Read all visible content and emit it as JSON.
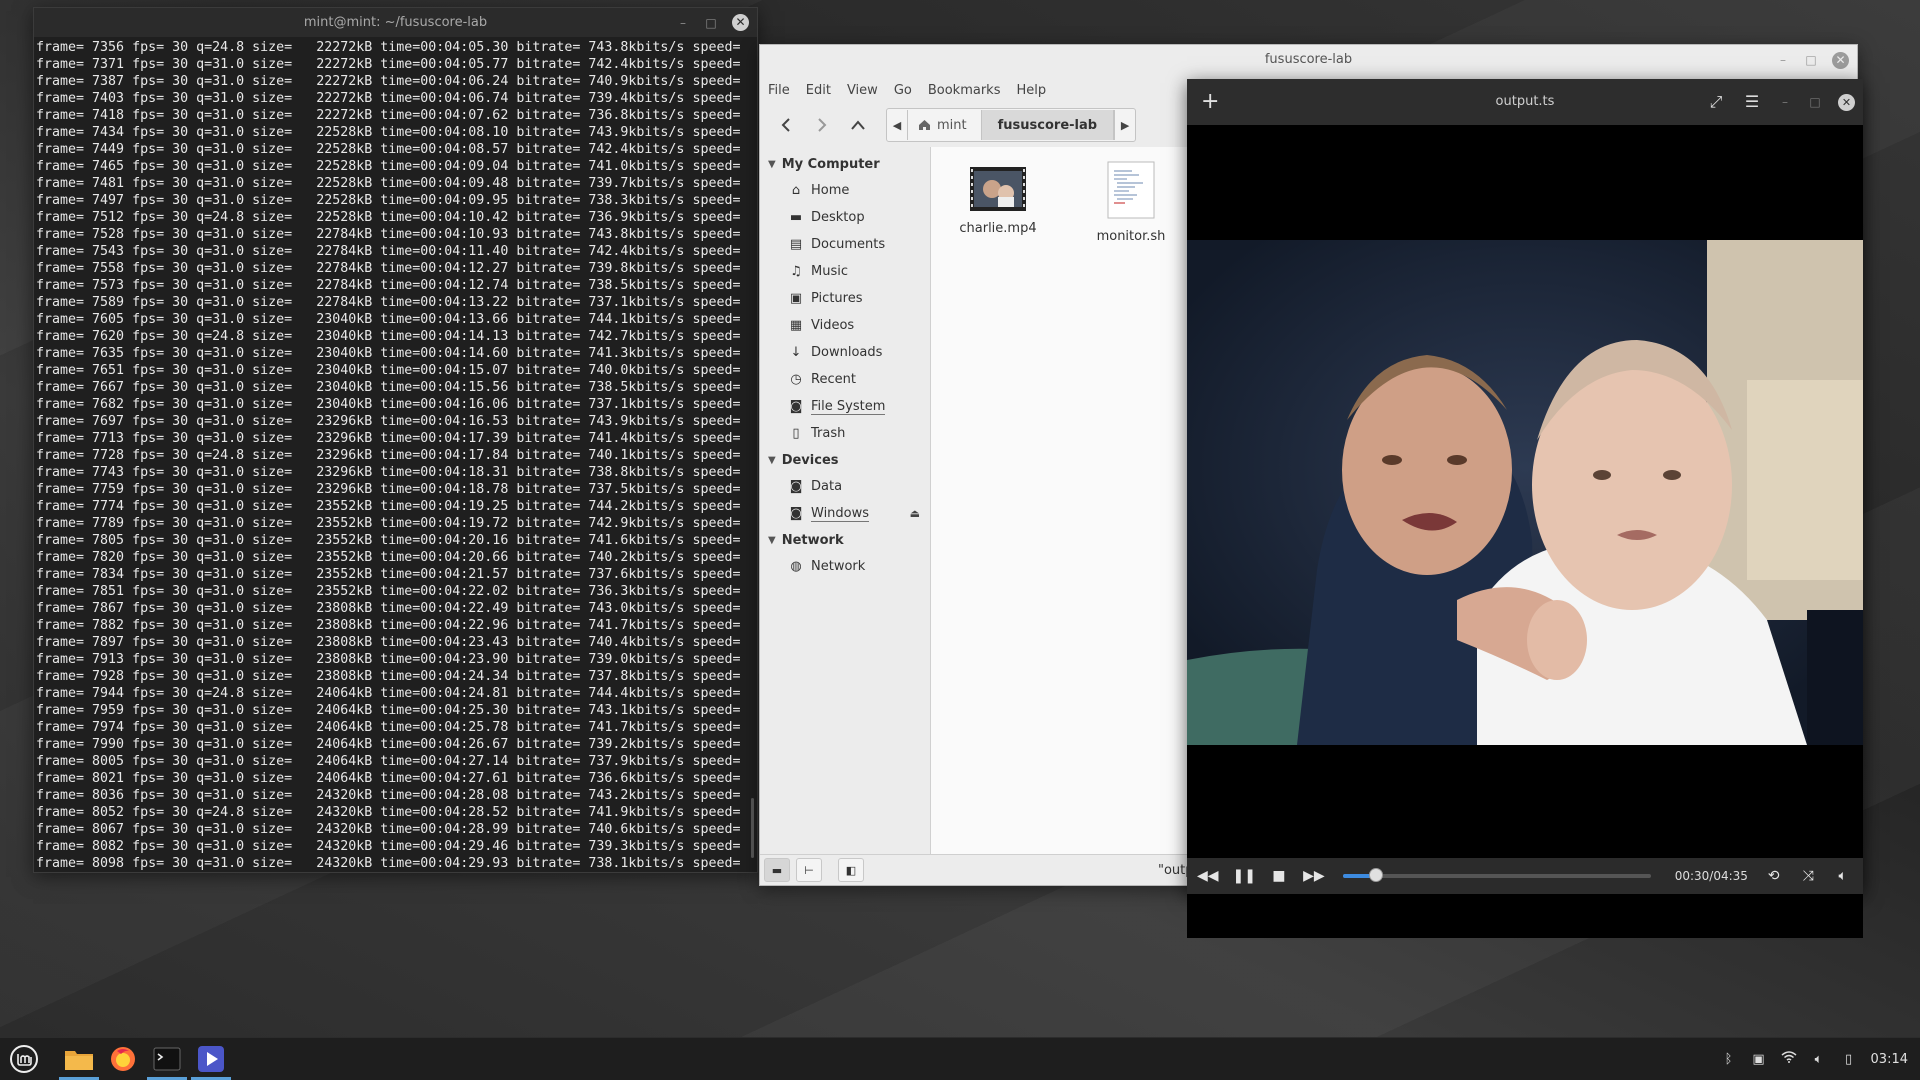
{
  "terminal": {
    "title": "mint@mint: ~/fususcore-lab",
    "lines": [
      "frame= 7356 fps= 30 q=24.8 size=   22272kB time=00:04:05.30 bitrate= 743.8kbits/s speed=",
      "frame= 7371 fps= 30 q=31.0 size=   22272kB time=00:04:05.77 bitrate= 742.4kbits/s speed=",
      "frame= 7387 fps= 30 q=31.0 size=   22272kB time=00:04:06.24 bitrate= 740.9kbits/s speed=",
      "frame= 7403 fps= 30 q=31.0 size=   22272kB time=00:04:06.74 bitrate= 739.4kbits/s speed=",
      "frame= 7418 fps= 30 q=31.0 size=   22272kB time=00:04:07.62 bitrate= 736.8kbits/s speed=",
      "frame= 7434 fps= 30 q=31.0 size=   22528kB time=00:04:08.10 bitrate= 743.9kbits/s speed=",
      "frame= 7449 fps= 30 q=31.0 size=   22528kB time=00:04:08.57 bitrate= 742.4kbits/s speed=",
      "frame= 7465 fps= 30 q=31.0 size=   22528kB time=00:04:09.04 bitrate= 741.0kbits/s speed=",
      "frame= 7481 fps= 30 q=31.0 size=   22528kB time=00:04:09.48 bitrate= 739.7kbits/s speed=",
      "frame= 7497 fps= 30 q=31.0 size=   22528kB time=00:04:09.95 bitrate= 738.3kbits/s speed=",
      "frame= 7512 fps= 30 q=24.8 size=   22528kB time=00:04:10.42 bitrate= 736.9kbits/s speed=",
      "frame= 7528 fps= 30 q=31.0 size=   22784kB time=00:04:10.93 bitrate= 743.8kbits/s speed=",
      "frame= 7543 fps= 30 q=31.0 size=   22784kB time=00:04:11.40 bitrate= 742.4kbits/s speed=",
      "frame= 7558 fps= 30 q=31.0 size=   22784kB time=00:04:12.27 bitrate= 739.8kbits/s speed=",
      "frame= 7573 fps= 30 q=31.0 size=   22784kB time=00:04:12.74 bitrate= 738.5kbits/s speed=",
      "frame= 7589 fps= 30 q=31.0 size=   22784kB time=00:04:13.22 bitrate= 737.1kbits/s speed=",
      "frame= 7605 fps= 30 q=31.0 size=   23040kB time=00:04:13.66 bitrate= 744.1kbits/s speed=",
      "frame= 7620 fps= 30 q=24.8 size=   23040kB time=00:04:14.13 bitrate= 742.7kbits/s speed=",
      "frame= 7635 fps= 30 q=31.0 size=   23040kB time=00:04:14.60 bitrate= 741.3kbits/s speed=",
      "frame= 7651 fps= 30 q=31.0 size=   23040kB time=00:04:15.07 bitrate= 740.0kbits/s speed=",
      "frame= 7667 fps= 30 q=31.0 size=   23040kB time=00:04:15.56 bitrate= 738.5kbits/s speed=",
      "frame= 7682 fps= 30 q=31.0 size=   23040kB time=00:04:16.06 bitrate= 737.1kbits/s speed=",
      "frame= 7697 fps= 30 q=31.0 size=   23296kB time=00:04:16.53 bitrate= 743.9kbits/s speed=",
      "frame= 7713 fps= 30 q=31.0 size=   23296kB time=00:04:17.39 bitrate= 741.4kbits/s speed=",
      "frame= 7728 fps= 30 q=24.8 size=   23296kB time=00:04:17.84 bitrate= 740.1kbits/s speed=",
      "frame= 7743 fps= 30 q=31.0 size=   23296kB time=00:04:18.31 bitrate= 738.8kbits/s speed=",
      "frame= 7759 fps= 30 q=31.0 size=   23296kB time=00:04:18.78 bitrate= 737.5kbits/s speed=",
      "frame= 7774 fps= 30 q=31.0 size=   23552kB time=00:04:19.25 bitrate= 744.2kbits/s speed=",
      "frame= 7789 fps= 30 q=31.0 size=   23552kB time=00:04:19.72 bitrate= 742.9kbits/s speed=",
      "frame= 7805 fps= 30 q=31.0 size=   23552kB time=00:04:20.16 bitrate= 741.6kbits/s speed=",
      "frame= 7820 fps= 30 q=31.0 size=   23552kB time=00:04:20.66 bitrate= 740.2kbits/s speed=",
      "frame= 7834 fps= 30 q=31.0 size=   23552kB time=00:04:21.57 bitrate= 737.6kbits/s speed=",
      "frame= 7851 fps= 30 q=31.0 size=   23552kB time=00:04:22.02 bitrate= 736.3kbits/s speed=",
      "frame= 7867 fps= 30 q=31.0 size=   23808kB time=00:04:22.49 bitrate= 743.0kbits/s speed=",
      "frame= 7882 fps= 30 q=31.0 size=   23808kB time=00:04:22.96 bitrate= 741.7kbits/s speed=",
      "frame= 7897 fps= 30 q=31.0 size=   23808kB time=00:04:23.43 bitrate= 740.4kbits/s speed=",
      "frame= 7913 fps= 30 q=31.0 size=   23808kB time=00:04:23.90 bitrate= 739.0kbits/s speed=",
      "frame= 7928 fps= 30 q=31.0 size=   23808kB time=00:04:24.34 bitrate= 737.8kbits/s speed=",
      "frame= 7944 fps= 30 q=24.8 size=   24064kB time=00:04:24.81 bitrate= 744.4kbits/s speed=",
      "frame= 7959 fps= 30 q=31.0 size=   24064kB time=00:04:25.30 bitrate= 743.1kbits/s speed=",
      "frame= 7974 fps= 30 q=31.0 size=   24064kB time=00:04:25.78 bitrate= 741.7kbits/s speed=",
      "frame= 7990 fps= 30 q=31.0 size=   24064kB time=00:04:26.67 bitrate= 739.2kbits/s speed=",
      "frame= 8005 fps= 30 q=31.0 size=   24064kB time=00:04:27.14 bitrate= 737.9kbits/s speed=",
      "frame= 8021 fps= 30 q=31.0 size=   24064kB time=00:04:27.61 bitrate= 736.6kbits/s speed=",
      "frame= 8036 fps= 30 q=31.0 size=   24320kB time=00:04:28.08 bitrate= 743.2kbits/s speed=",
      "frame= 8052 fps= 30 q=24.8 size=   24320kB time=00:04:28.52 bitrate= 741.9kbits/s speed=",
      "frame= 8067 fps= 30 q=31.0 size=   24320kB time=00:04:28.99 bitrate= 740.6kbits/s speed=",
      "frame= 8082 fps= 30 q=31.0 size=   24320kB time=00:04:29.46 bitrate= 739.3kbits/s speed=",
      "frame= 8098 fps= 30 q=31.0 size=   24320kB time=00:04:29.93 bitrate= 738.1kbits/s speed="
    ]
  },
  "filemgr": {
    "title": "fususcore-lab",
    "menu": [
      "File",
      "Edit",
      "View",
      "Go",
      "Bookmarks",
      "Help"
    ],
    "breadcrumb": {
      "home": "mint",
      "current": "fususcore-lab"
    },
    "sidebar": {
      "my_computer": "My Computer",
      "places": [
        {
          "label": "Home",
          "icon": "home-icon"
        },
        {
          "label": "Desktop",
          "icon": "desktop-icon"
        },
        {
          "label": "Documents",
          "icon": "documents-icon"
        },
        {
          "label": "Music",
          "icon": "music-icon"
        },
        {
          "label": "Pictures",
          "icon": "pictures-icon"
        },
        {
          "label": "Videos",
          "icon": "videos-icon"
        },
        {
          "label": "Downloads",
          "icon": "downloads-icon"
        },
        {
          "label": "Recent",
          "icon": "recent-icon"
        },
        {
          "label": "File System",
          "icon": "drive-icon"
        },
        {
          "label": "Trash",
          "icon": "trash-icon"
        }
      ],
      "devices_header": "Devices",
      "devices": [
        {
          "label": "Data",
          "icon": "drive-icon"
        },
        {
          "label": "Windows",
          "icon": "drive-icon"
        }
      ],
      "network_header": "Network",
      "network": [
        {
          "label": "Network",
          "icon": "network-icon"
        }
      ]
    },
    "files": [
      {
        "name": "charlie.mp4",
        "type": "video"
      },
      {
        "name": "monitor.sh",
        "type": "script"
      }
    ],
    "status": "\"outp"
  },
  "player": {
    "title": "output.ts",
    "time": "00:30/04:35",
    "progress": 0.109
  },
  "taskbar": {
    "clock": "03:14"
  }
}
